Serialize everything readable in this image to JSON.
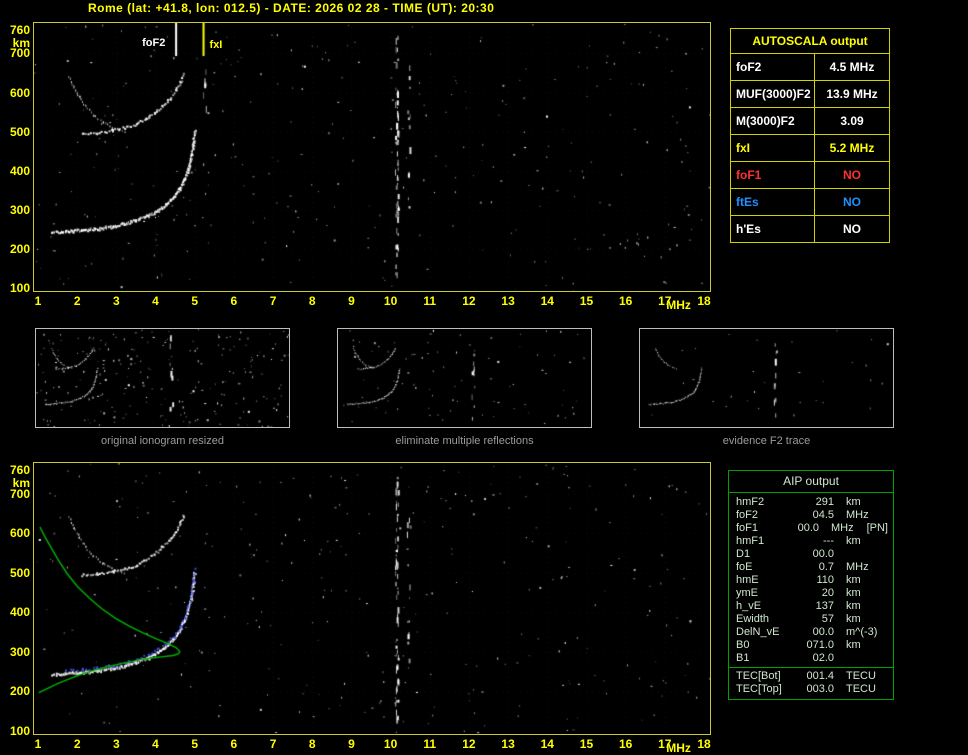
{
  "header": {
    "title": "Rome (lat: +41.8, lon: 012.5) - DATE: 2026 02 28 - TIME (UT): 20:30"
  },
  "colors": {
    "accent_yellow": "#ffff00",
    "plot_border_yellow": "#c9c932",
    "table_border_yellow": "#d2d200",
    "red": "#ff3030",
    "blue": "#1e90ff",
    "green": "#00b400",
    "trace_white": "#ffffff",
    "autoscaled_trace_blue": "#4455ff",
    "caption_gray": "#9c9c9c"
  },
  "autoscala_table": {
    "title": "AUTOSCALA output",
    "rows": [
      {
        "label": "foF2",
        "value": "4.5 MHz",
        "color": "#ffffff"
      },
      {
        "label": "MUF(3000)F2",
        "value": "13.9 MHz",
        "color": "#ffffff"
      },
      {
        "label": "M(3000)F2",
        "value": "3.09",
        "color": "#ffffff"
      },
      {
        "label": "fxI",
        "value": "5.2 MHz",
        "color": "#ffff00"
      },
      {
        "label": "foF1",
        "value": "NO",
        "color": "#ff3030"
      },
      {
        "label": "ftEs",
        "value": "NO",
        "color": "#1e90ff"
      },
      {
        "label": "h'Es",
        "value": "NO",
        "color": "#ffffff"
      }
    ]
  },
  "thumbnails": [
    {
      "caption": "original ionogram resized"
    },
    {
      "caption": "eliminate multiple reflections"
    },
    {
      "caption": "evidence F2 trace"
    }
  ],
  "aip_table": {
    "title": "AIP output",
    "rows": [
      {
        "label": "hmF2",
        "value": "291",
        "unit": "km",
        "note": ""
      },
      {
        "label": "foF2",
        "value": "04.5",
        "unit": "MHz",
        "note": ""
      },
      {
        "label": "foF1",
        "value": "00.0",
        "unit": "MHz",
        "note": "[PN]"
      },
      {
        "label": "hmF1",
        "value": "---",
        "unit": "km",
        "note": ""
      },
      {
        "label": "D1",
        "value": "00.0",
        "unit": "",
        "note": ""
      },
      {
        "label": "foE",
        "value": "0.7",
        "unit": "MHz",
        "note": ""
      },
      {
        "label": "hmE",
        "value": "110",
        "unit": "km",
        "note": ""
      },
      {
        "label": "ymE",
        "value": "20",
        "unit": "km",
        "note": ""
      },
      {
        "label": "h_vE",
        "value": "137",
        "unit": "km",
        "note": ""
      },
      {
        "label": "Ewidth",
        "value": "57",
        "unit": "km",
        "note": ""
      },
      {
        "label": "DelN_vE",
        "value": "00.0",
        "unit": "m^(-3)",
        "note": ""
      },
      {
        "label": "B0",
        "value": "071.0",
        "unit": "km",
        "note": ""
      },
      {
        "label": "B1",
        "value": "02.0",
        "unit": "",
        "note": ""
      }
    ],
    "tec_rows": [
      {
        "label": "TEC[Bot]",
        "value": "001.4",
        "unit": "TECU"
      },
      {
        "label": "TEC[Top]",
        "value": "003.0",
        "unit": "TECU"
      }
    ]
  },
  "chart_data": {
    "type": "scatter",
    "axes": {
      "x_unit": "MHz",
      "y_unit": "km",
      "xlim": [
        1,
        18
      ],
      "ylim": [
        100,
        760
      ],
      "x_ticks": [
        1,
        2,
        3,
        4,
        5,
        6,
        7,
        8,
        9,
        10,
        11,
        12,
        13,
        14,
        15,
        16,
        17,
        18
      ],
      "y_ticks": [
        760,
        700,
        600,
        500,
        400,
        300,
        200,
        100
      ]
    },
    "plots": [
      {
        "id": "top",
        "description": "recorded ionogram with autoscaled characteristics",
        "annotations": [
          {
            "label": "foF2",
            "x": 4.5,
            "color": "#ffffff",
            "side": "left"
          },
          {
            "label": "fxI",
            "x": 5.2,
            "color": "#ffff00",
            "side": "right"
          }
        ],
        "series": [
          "f2_trace",
          "second_hop",
          "second_hop_descend"
        ],
        "interference_lines_mhz": [
          10.15,
          10.45,
          5.25
        ]
      },
      {
        "id": "bottom",
        "description": "ionogram with autoscaled trace (blue dots) and electron density profile (green)",
        "annotations": [],
        "series": [
          "f2_trace",
          "second_hop",
          "second_hop_descend",
          "autoscaled_trace_dots",
          "electron_density_profile"
        ],
        "interference_lines_mhz": [
          10.15,
          10.45
        ]
      }
    ],
    "traces": {
      "f2_trace": [
        [
          1.35,
          244
        ],
        [
          1.7,
          246
        ],
        [
          2.1,
          249
        ],
        [
          2.5,
          253
        ],
        [
          2.9,
          259
        ],
        [
          3.2,
          266
        ],
        [
          3.5,
          275
        ],
        [
          3.8,
          287
        ],
        [
          4.05,
          300
        ],
        [
          4.25,
          315
        ],
        [
          4.45,
          334
        ],
        [
          4.6,
          356
        ],
        [
          4.72,
          380
        ],
        [
          4.82,
          408
        ],
        [
          4.9,
          440
        ],
        [
          4.95,
          472
        ],
        [
          4.98,
          502
        ]
      ],
      "second_hop": [
        [
          2.1,
          496
        ],
        [
          2.5,
          499
        ],
        [
          2.9,
          505
        ],
        [
          3.2,
          512
        ],
        [
          3.5,
          522
        ],
        [
          3.75,
          535
        ],
        [
          3.95,
          550
        ],
        [
          4.15,
          566
        ],
        [
          4.35,
          586
        ],
        [
          4.5,
          606
        ],
        [
          4.62,
          628
        ],
        [
          4.7,
          648
        ]
      ],
      "second_hop_descend": [
        [
          1.78,
          642
        ],
        [
          1.9,
          616
        ],
        [
          2.05,
          590
        ],
        [
          2.2,
          568
        ],
        [
          2.4,
          545
        ],
        [
          2.65,
          525
        ],
        [
          2.95,
          510
        ],
        [
          3.2,
          503
        ]
      ],
      "electron_density_profile": [
        [
          1.02,
          197
        ],
        [
          1.25,
          208
        ],
        [
          1.5,
          220
        ],
        [
          1.8,
          232
        ],
        [
          2.1,
          243
        ],
        [
          2.45,
          254
        ],
        [
          2.8,
          263
        ],
        [
          3.15,
          271
        ],
        [
          3.5,
          278
        ],
        [
          3.85,
          284
        ],
        [
          4.2,
          288
        ],
        [
          4.45,
          291
        ],
        [
          4.58,
          295
        ],
        [
          4.62,
          301
        ],
        [
          4.52,
          311
        ],
        [
          4.32,
          321
        ],
        [
          4.02,
          333
        ],
        [
          3.68,
          348
        ],
        [
          3.33,
          365
        ],
        [
          2.98,
          385
        ],
        [
          2.63,
          409
        ],
        [
          2.3,
          437
        ],
        [
          2.0,
          466
        ],
        [
          1.75,
          497
        ],
        [
          1.52,
          532
        ],
        [
          1.32,
          566
        ],
        [
          1.16,
          594
        ],
        [
          1.05,
          616
        ]
      ]
    }
  }
}
